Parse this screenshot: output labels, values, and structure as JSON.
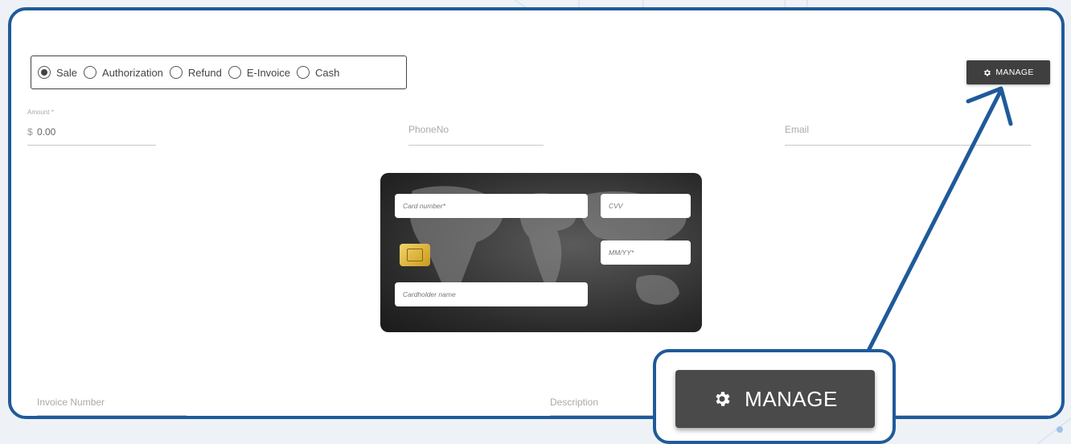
{
  "payment_types": [
    {
      "label": "Sale",
      "selected": true
    },
    {
      "label": "Authorization",
      "selected": false
    },
    {
      "label": "Refund",
      "selected": false
    },
    {
      "label": "E-Invoice",
      "selected": false
    },
    {
      "label": "Cash",
      "selected": false
    }
  ],
  "toolbar": {
    "manage_label": "MANAGE",
    "manage_icon": "gear-icon"
  },
  "fields": {
    "amount_label": "Amount *",
    "amount_currency": "$",
    "amount_value": "0.00",
    "phone_placeholder": "PhoneNo",
    "email_placeholder": "Email",
    "invoice_placeholder": "Invoice Number",
    "description_placeholder": "Description"
  },
  "card": {
    "card_number_placeholder": "Card number*",
    "cvv_placeholder": "CVV",
    "expiry_placeholder": "MM/YY*",
    "cardholder_placeholder": "Cardholder name"
  },
  "callout": {
    "manage_label": "MANAGE"
  },
  "colors": {
    "accent": "#1f5a9a",
    "button": "#3f3f3f"
  }
}
